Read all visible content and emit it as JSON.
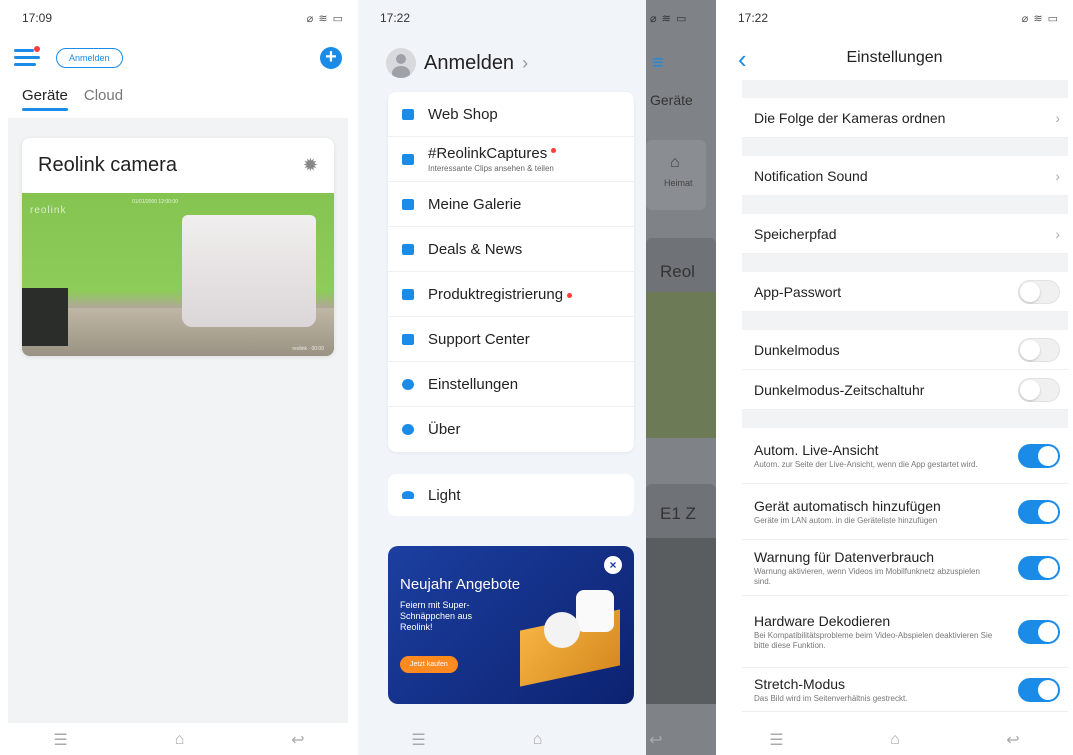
{
  "panel1": {
    "time": "17:09",
    "status_icons": "⌀ ≋ ▭",
    "login_label": "Anmelden",
    "add_label": "+",
    "tabs": [
      "Geräte",
      "Cloud"
    ],
    "camera_title": "Reolink camera",
    "camera_brand": "reolink",
    "camera_stamp": "01/01/2000 12:00:00",
    "camera_stamp2": "reolink · 00:00",
    "icon_gear": "gear-icon"
  },
  "panel2": {
    "time": "17:22",
    "status_icons": "⌀ ≋ ▭",
    "user_label": "Anmelden",
    "user_chevron": "›",
    "menu": [
      {
        "label": "Web Shop",
        "sub": "",
        "dot": false
      },
      {
        "label": "#ReolinkCaptures",
        "sub": "Interessante Clips ansehen & teilen",
        "dot": true
      },
      {
        "label": "Meine Galerie",
        "sub": "",
        "dot": false
      },
      {
        "label": "Deals & News",
        "sub": "",
        "dot": false
      },
      {
        "label": "Produktregistrierung",
        "sub": "",
        "dot": true
      },
      {
        "label": "Support Center",
        "sub": "",
        "dot": false
      },
      {
        "label": "Einstellungen",
        "sub": "",
        "dot": false
      },
      {
        "label": "Über",
        "sub": "",
        "dot": false
      }
    ],
    "light_label": "Light",
    "promo": {
      "title": "Neujahr Angebote",
      "sub": "Feiern mit Super-Schnäppchen aus Reolink!",
      "button": "Jetzt kaufen",
      "close": "×"
    },
    "strip": {
      "tab": "Geräte",
      "home": "Heimat",
      "card1": "Reol",
      "card2": "E1 Z"
    }
  },
  "panel3": {
    "time": "17:22",
    "status_icons": "⌀ ≋ ▭",
    "title": "Einstellungen",
    "back": "‹",
    "rows": {
      "order": "Die Folge der Kameras ordnen",
      "sound": "Notification Sound",
      "storage": "Speicherpfad",
      "app_password": "App-Passwort",
      "dark": "Dunkelmodus",
      "dark_timer": "Dunkelmodus-Zeitschaltuhr"
    },
    "toggles": [
      {
        "title": "Autom. Live-Ansicht",
        "sub": "Autom. zur Seite der Live-Ansicht, wenn die App gestartet wird.",
        "on": true
      },
      {
        "title": "Gerät automatisch hinzufügen",
        "sub": "Geräte im LAN autom. in die Geräteliste hinzufügen",
        "on": true
      },
      {
        "title": "Warnung für Datenverbrauch",
        "sub": "Warnung aktivieren, wenn Videos im Mobilfunknetz abzuspielen sind.",
        "on": true
      },
      {
        "title": "Hardware Dekodieren",
        "sub": "Bei Kompatibilitätsprobleme beim Video-Abspielen deaktivieren Sie bitte diese Funktion.",
        "on": true
      },
      {
        "title": "Stretch-Modus",
        "sub": "Das Bild wird im Seitenverhältnis gestreckt.",
        "on": true
      }
    ]
  },
  "nav": {
    "menu": "☰",
    "home": "⌂",
    "back": "↩"
  },
  "colors": {
    "accent": "#1a8ce8",
    "alert": "#ff3b3b",
    "bg_gray": "#f2f3f5"
  }
}
